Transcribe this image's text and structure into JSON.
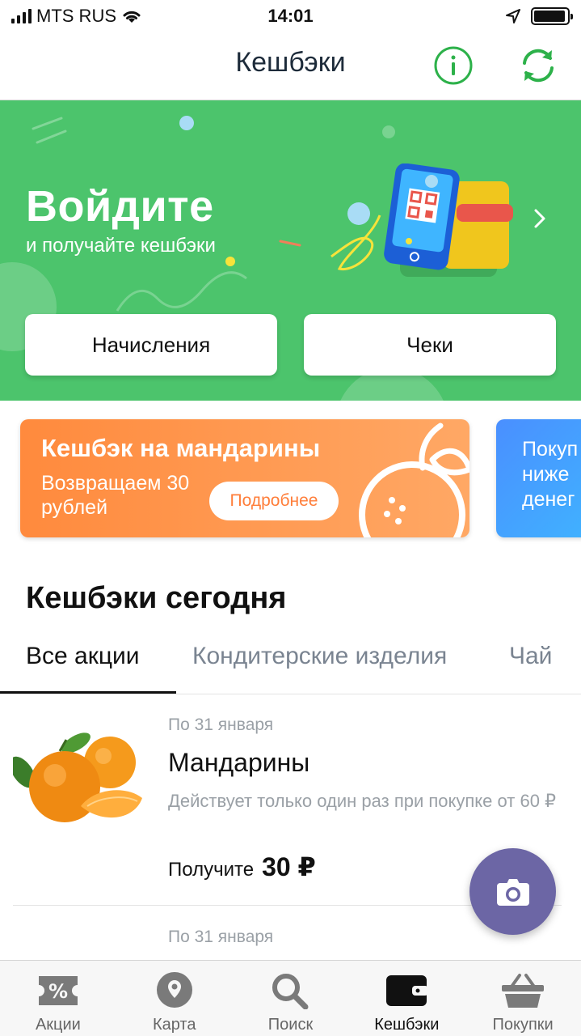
{
  "status_bar": {
    "carrier": "MTS RUS",
    "time": "14:01",
    "battery_level": 0.95
  },
  "nav": {
    "title": "Кешбэки",
    "info_icon": "info-icon",
    "refresh_icon": "refresh-icon"
  },
  "hero": {
    "title": "Войдите",
    "subtitle": "и получайте кешбэки",
    "accruals_button": "Начисления",
    "receipts_button": "Чеки",
    "background_color": "#4cc46c"
  },
  "promos": [
    {
      "title": "Кешбэк на мандарины",
      "text": "Возвращаем 30 рублей",
      "button": "Подробнее",
      "color": "#ff8a3d"
    },
    {
      "text_line1": "Покуп",
      "text_line2": "ниже",
      "text_line3": "денег",
      "color": "#4a8fff"
    }
  ],
  "section": {
    "title": "Кешбэки сегодня"
  },
  "tabs": [
    {
      "label": "Все акции",
      "active": true
    },
    {
      "label": "Кондитерские изделия",
      "active": false
    },
    {
      "label": "Чай",
      "active": false
    }
  ],
  "products": [
    {
      "date": "По 31 января",
      "name": "Мандарины",
      "description": "Действует только один раз при покупке от 60 ₽",
      "reward_label": "Получите",
      "reward_amount": "30 ₽"
    },
    {
      "date": "По 31 января"
    }
  ],
  "fab": {
    "icon": "camera-icon",
    "color": "#6c66a5"
  },
  "tab_bar": [
    {
      "label": "Акции",
      "icon": "discount-ticket-icon"
    },
    {
      "label": "Карта",
      "icon": "map-pin-icon"
    },
    {
      "label": "Поиск",
      "icon": "search-icon"
    },
    {
      "label": "Кешбэки",
      "icon": "wallet-icon",
      "active": true
    },
    {
      "label": "Покупки",
      "icon": "basket-icon"
    }
  ]
}
